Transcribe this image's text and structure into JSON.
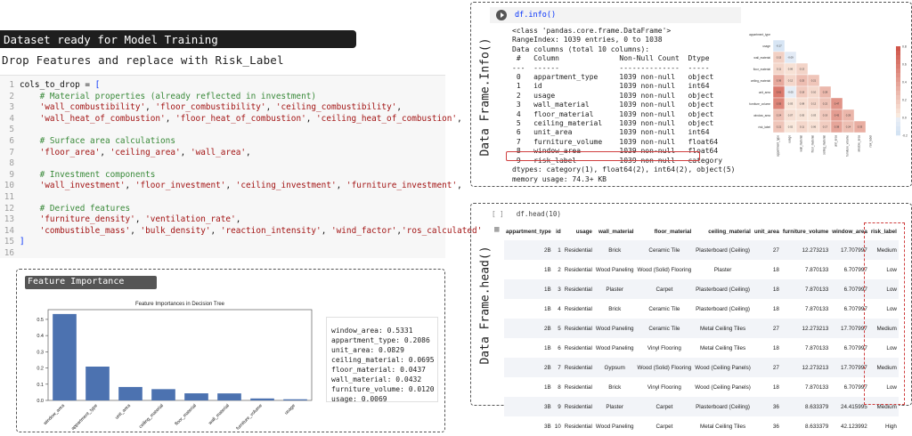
{
  "header": {
    "title": "Dataset ready for Model Training",
    "subtitle": "Drop Features and replace  with Risk_Label"
  },
  "code": {
    "lines": [
      {
        "n": "1",
        "parts": [
          [
            "kw",
            "cols_to_drop = "
          ],
          [
            "br",
            "["
          ]
        ]
      },
      {
        "n": "2",
        "parts": [
          [
            "cmt",
            "    # Material properties (already reflected in investment)"
          ]
        ]
      },
      {
        "n": "3",
        "parts": [
          [
            "str",
            "    'wall_combustibility'"
          ],
          [
            "kw",
            ", "
          ],
          [
            "str",
            "'floor_combustibility'"
          ],
          [
            "kw",
            ", "
          ],
          [
            "str",
            "'ceiling_combustibility'"
          ],
          [
            "kw",
            ","
          ]
        ]
      },
      {
        "n": "4",
        "parts": [
          [
            "str",
            "    'wall_heat_of_combustion'"
          ],
          [
            "kw",
            ", "
          ],
          [
            "str",
            "'floor_heat_of_combustion'"
          ],
          [
            "kw",
            ", "
          ],
          [
            "str",
            "'ceiling_heat_of_combustion'"
          ],
          [
            "kw",
            ","
          ]
        ]
      },
      {
        "n": "5",
        "parts": []
      },
      {
        "n": "6",
        "parts": [
          [
            "cmt",
            "    # Surface area calculations"
          ]
        ]
      },
      {
        "n": "7",
        "parts": [
          [
            "str",
            "    'floor_area'"
          ],
          [
            "kw",
            ", "
          ],
          [
            "str",
            "'ceiling_area'"
          ],
          [
            "kw",
            ", "
          ],
          [
            "str",
            "'wall_area'"
          ],
          [
            "kw",
            ","
          ]
        ]
      },
      {
        "n": "8",
        "parts": []
      },
      {
        "n": "9",
        "parts": [
          [
            "cmt",
            "    # Investment components"
          ]
        ]
      },
      {
        "n": "10",
        "parts": [
          [
            "str",
            "    'wall_investment'"
          ],
          [
            "kw",
            ", "
          ],
          [
            "str",
            "'floor_investment'"
          ],
          [
            "kw",
            ", "
          ],
          [
            "str",
            "'ceiling_investment'"
          ],
          [
            "kw",
            ", "
          ],
          [
            "str",
            "'furniture_investment'"
          ],
          [
            "kw",
            ","
          ]
        ]
      },
      {
        "n": "11",
        "parts": []
      },
      {
        "n": "12",
        "parts": [
          [
            "cmt",
            "    # Derived features"
          ]
        ]
      },
      {
        "n": "13",
        "parts": [
          [
            "str",
            "    'furniture_density'"
          ],
          [
            "kw",
            ", "
          ],
          [
            "str",
            "'ventilation_rate'"
          ],
          [
            "kw",
            ","
          ]
        ]
      },
      {
        "n": "14",
        "parts": [
          [
            "str",
            "    'combustible_mass'"
          ],
          [
            "kw",
            ", "
          ],
          [
            "str",
            "'bulk_density'"
          ],
          [
            "kw",
            ", "
          ],
          [
            "str",
            "'reaction_intensity'"
          ],
          [
            "kw",
            ", "
          ],
          [
            "str",
            "'wind_factor'"
          ],
          [
            "kw",
            ","
          ],
          [
            "str",
            "'ros_calculated'"
          ]
        ]
      },
      {
        "n": "15",
        "parts": [
          [
            "br",
            "]"
          ]
        ]
      },
      {
        "n": "16",
        "parts": []
      }
    ]
  },
  "feature_importance": {
    "tag": "Feature Importance",
    "output_lines": [
      "window_area: 0.5331",
      "appartment_type: 0.2086",
      "unit_area: 0.0829",
      "ceiling_material: 0.0695",
      "floor_material: 0.0437",
      "wall_material: 0.0432",
      "furniture_volume: 0.0120",
      "usage: 0.0069"
    ]
  },
  "chart_data": {
    "type": "bar",
    "title": "Feature Importances in Decision Tree",
    "categories": [
      "window_area",
      "appartment_type",
      "unit_area",
      "ceiling_material",
      "floor_material",
      "wall_material",
      "furniture_volume",
      "usage"
    ],
    "values": [
      0.5331,
      0.2086,
      0.0829,
      0.0695,
      0.0437,
      0.0432,
      0.012,
      0.0069
    ],
    "ylim": [
      0,
      0.56
    ],
    "yticks": [
      "0.0",
      "0.1",
      "0.2",
      "0.3",
      "0.4",
      "0.5"
    ],
    "color": "#4c72b0"
  },
  "info": {
    "vertical_label": "Data Frame.Info()",
    "command": "df.info()",
    "output": [
      "<class 'pandas.core.frame.DataFrame'>",
      "RangeIndex: 1039 entries, 0 to 1038",
      "Data columns (total 10 columns):",
      " #   Column              Non-Null Count  Dtype",
      "---  ------              --------------  -----",
      " 0   appartment_type     1039 non-null   object",
      " 1   id                  1039 non-null   int64",
      " 2   usage               1039 non-null   object",
      " 3   wall_material       1039 non-null   object",
      " 4   floor_material      1039 non-null   object",
      " 5   ceiling_material    1039 non-null   object",
      " 6   unit_area           1039 non-null   int64",
      " 7   furniture_volume    1039 non-null   float64",
      " 8   window_area         1039 non-null   float64",
      " 9   risk_label          1039 non-null   category",
      "dtypes: category(1), float64(2), int64(2), object(5)",
      "memory usage: 74.3+ KB"
    ]
  },
  "heatmap": {
    "labels": [
      "appartment_type",
      "usage",
      "wall_material",
      "floor_material",
      "ceiling_material",
      "unit_area",
      "furniture_volume",
      "window_area",
      "risk_label"
    ],
    "cells": [
      [],
      [
        "-0.17"
      ],
      [
        "0.15",
        "-0.09"
      ],
      [
        "0.11",
        "0.06",
        "0.13"
      ],
      [
        "0.36",
        "0.12",
        "0.25",
        "0.21"
      ],
      [
        "0.61",
        "-0.05",
        "0.18",
        "0.10",
        "0.28"
      ],
      [
        "0.55",
        "0.03",
        "0.08",
        "0.12",
        "0.22",
        "0.47"
      ],
      [
        "0.24",
        "0.07",
        "0.05",
        "0.03",
        "0.19",
        "0.42",
        "0.29"
      ],
      [
        "0.21",
        "0.02",
        "0.11",
        "0.06",
        "0.17",
        "0.38",
        "0.24",
        "0.33"
      ]
    ],
    "scale_ticks": [
      "0.8",
      "0.6",
      "0.4",
      "0.2",
      "0.0",
      "-0.2"
    ]
  },
  "head": {
    "vertical_label": "Data Frame.head()",
    "command": "df.head(10)",
    "bracket": "[ ]",
    "columns": [
      "appartment_type",
      "id",
      "usage",
      "wall_material",
      "floor_material",
      "ceiling_material",
      "unit_area",
      "furniture_volume",
      "window_area",
      "risk_label"
    ],
    "rows": [
      [
        "2B",
        "1",
        "Residential",
        "Brick",
        "Ceramic Tile",
        "Plasterboard (Ceiling)",
        "27",
        "12.273213",
        "17.707997",
        "Medium"
      ],
      [
        "1B",
        "2",
        "Residential",
        "Wood Paneling",
        "Wood (Solid) Flooring",
        "Plaster",
        "18",
        "7.870133",
        "6.707997",
        "Low"
      ],
      [
        "1B",
        "3",
        "Residential",
        "Plaster",
        "Carpet",
        "Plasterboard (Ceiling)",
        "18",
        "7.870133",
        "6.707997",
        "Low"
      ],
      [
        "1B",
        "4",
        "Residential",
        "Brick",
        "Ceramic Tile",
        "Plasterboard (Ceiling)",
        "18",
        "7.870133",
        "6.707997",
        "Low"
      ],
      [
        "2B",
        "5",
        "Residential",
        "Wood Paneling",
        "Ceramic Tile",
        "Metal Ceiling Tiles",
        "27",
        "12.273213",
        "17.707997",
        "Medium"
      ],
      [
        "1B",
        "6",
        "Residential",
        "Wood Paneling",
        "Vinyl Flooring",
        "Metal Ceiling Tiles",
        "18",
        "7.870133",
        "6.707997",
        "Low"
      ],
      [
        "2B",
        "7",
        "Residential",
        "Gypsum",
        "Wood (Solid) Flooring",
        "Wood (Ceiling Panels)",
        "27",
        "12.273213",
        "17.707997",
        "Medium"
      ],
      [
        "1B",
        "8",
        "Residential",
        "Brick",
        "Vinyl Flooring",
        "Wood (Ceiling Panels)",
        "18",
        "7.870133",
        "6.707997",
        "Low"
      ],
      [
        "3B",
        "9",
        "Residential",
        "Plaster",
        "Carpet",
        "Plasterboard (Ceiling)",
        "36",
        "8.633379",
        "24.415995",
        "Medium"
      ],
      [
        "3B",
        "10",
        "Residential",
        "Wood Paneling",
        "Carpet",
        "Metal Ceiling Tiles",
        "36",
        "8.633379",
        "42.123992",
        "High"
      ]
    ]
  }
}
